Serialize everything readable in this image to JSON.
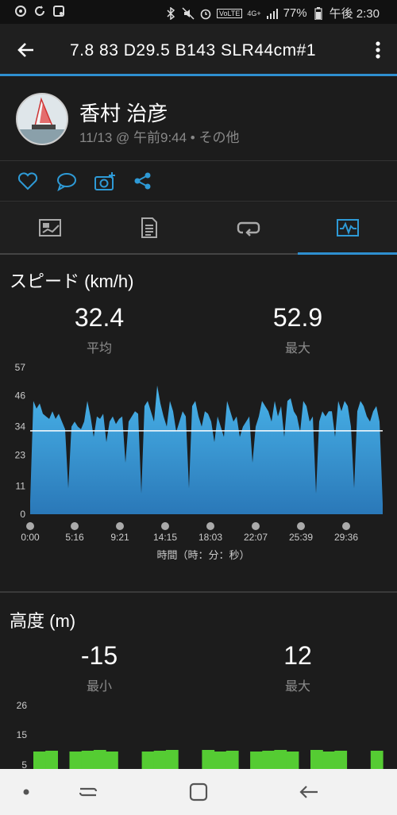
{
  "status_bar": {
    "left_icons": [
      "sync-icon",
      "refresh-icon",
      "image-icon"
    ],
    "lte_label": "VoLTE",
    "network_label": "4G+",
    "battery": "77%",
    "time": "午後 2:30"
  },
  "app_bar": {
    "title": "7.8   83   D29.5  B143  SLR44cm#1"
  },
  "header": {
    "user_name": "香村 治彦",
    "activity_meta": "11/13 @ 午前9:44 • その他"
  },
  "actions": [
    "like-icon",
    "comment-icon",
    "camera-add-icon",
    "share-icon"
  ],
  "tabs": [
    {
      "name": "summary",
      "icon": "summary-icon"
    },
    {
      "name": "stats",
      "icon": "document-icon"
    },
    {
      "name": "laps",
      "icon": "laps-icon"
    },
    {
      "name": "charts",
      "icon": "chart-icon",
      "active": true
    }
  ],
  "speed": {
    "title": "スピード (km/h)",
    "avg_value": "32.4",
    "avg_label": "平均",
    "max_value": "52.9",
    "max_label": "最大"
  },
  "elevation": {
    "title": "高度 (m)",
    "min_value": "-15",
    "min_label": "最小",
    "max_value": "12",
    "max_label": "最大"
  },
  "chart_data": [
    {
      "type": "area",
      "title": "スピード (km/h)",
      "xlabel": "時間（時：分：秒）",
      "ylabel": "",
      "y_ticks": [
        "57",
        "46",
        "34",
        "23",
        "11",
        "0"
      ],
      "x_ticks": [
        "0:00",
        "5:16",
        "9:21",
        "14:15",
        "18:03",
        "22:07",
        "25:39",
        "29:36"
      ],
      "ylim": [
        0,
        57
      ],
      "average": 32.4,
      "color": "#3aa0dc",
      "values": [
        5,
        44,
        41,
        43,
        39,
        38,
        37,
        40,
        37,
        39,
        36,
        33,
        10,
        34,
        36,
        34,
        33,
        36,
        44,
        38,
        30,
        38,
        37,
        39,
        28,
        36,
        38,
        35,
        37,
        38,
        20,
        36,
        38,
        40,
        39,
        8,
        42,
        44,
        40,
        36,
        50,
        43,
        38,
        34,
        44,
        40,
        32,
        36,
        40,
        38,
        10,
        42,
        44,
        38,
        34,
        40,
        39,
        36,
        28,
        38,
        34,
        30,
        44,
        40,
        36,
        38,
        30,
        34,
        36,
        38,
        20,
        34,
        38,
        44,
        42,
        40,
        36,
        44,
        38,
        42,
        30,
        44,
        45,
        40,
        38,
        32,
        44,
        42,
        36,
        38,
        8,
        36,
        40,
        38,
        40,
        40,
        30,
        44,
        40,
        44,
        42,
        34,
        10,
        40,
        44,
        42,
        38,
        36,
        40,
        42,
        36,
        4
      ],
      "y_min_label": "0"
    },
    {
      "type": "area",
      "title": "高度 (m)",
      "y_ticks": [
        "26",
        "15",
        "5"
      ],
      "color": "#55cc33",
      "values": [
        3,
        3,
        0,
        3,
        3,
        3,
        3,
        0,
        0,
        3,
        3,
        3,
        0,
        0,
        3,
        3,
        3,
        0,
        3,
        3,
        3,
        3,
        0,
        3,
        3,
        3,
        0,
        0,
        3
      ]
    }
  ]
}
